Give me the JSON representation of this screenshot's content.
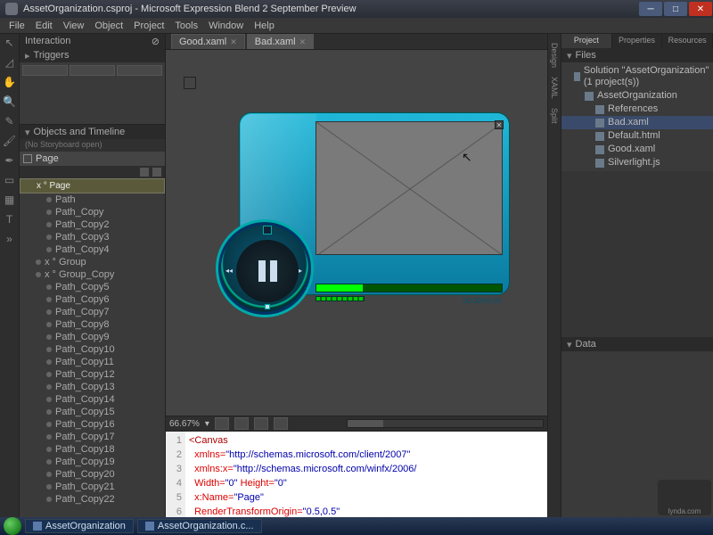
{
  "title": "AssetOrganization.csproj - Microsoft Expression Blend 2 September Preview",
  "menu": [
    "File",
    "Edit",
    "View",
    "Object",
    "Project",
    "Tools",
    "Window",
    "Help"
  ],
  "left": {
    "interaction": "Interaction",
    "triggers": "Triggers",
    "objects": "Objects and Timeline",
    "storyboard": "(No Storyboard open)",
    "root": "Page",
    "selected": "x ° Page",
    "items": [
      {
        "l": "Path",
        "g": 0
      },
      {
        "l": "Path_Copy",
        "g": 0
      },
      {
        "l": "Path_Copy2",
        "g": 0
      },
      {
        "l": "Path_Copy3",
        "g": 0
      },
      {
        "l": "Path_Copy4",
        "g": 0
      },
      {
        "l": "x ° Group",
        "g": 1
      },
      {
        "l": "x ° Group_Copy",
        "g": 1
      },
      {
        "l": "Path_Copy5",
        "g": 0
      },
      {
        "l": "Path_Copy6",
        "g": 0
      },
      {
        "l": "Path_Copy7",
        "g": 0
      },
      {
        "l": "Path_Copy8",
        "g": 0
      },
      {
        "l": "Path_Copy9",
        "g": 0
      },
      {
        "l": "Path_Copy10",
        "g": 0
      },
      {
        "l": "Path_Copy11",
        "g": 0
      },
      {
        "l": "Path_Copy12",
        "g": 0
      },
      {
        "l": "Path_Copy13",
        "g": 0
      },
      {
        "l": "Path_Copy14",
        "g": 0
      },
      {
        "l": "Path_Copy15",
        "g": 0
      },
      {
        "l": "Path_Copy16",
        "g": 0
      },
      {
        "l": "Path_Copy17",
        "g": 0
      },
      {
        "l": "Path_Copy18",
        "g": 0
      },
      {
        "l": "Path_Copy19",
        "g": 0
      },
      {
        "l": "Path_Copy20",
        "g": 0
      },
      {
        "l": "Path_Copy21",
        "g": 0
      },
      {
        "l": "Path_Copy22",
        "g": 0
      }
    ]
  },
  "tabs": [
    {
      "label": "Good.xaml",
      "active": false
    },
    {
      "label": "Bad.xaml",
      "active": true
    }
  ],
  "zoom": "66.67%",
  "sidetabs": [
    "Design",
    "XAML",
    "Split"
  ],
  "right": {
    "tabs": [
      "Project",
      "Properties",
      "Resources"
    ],
    "files_header": "Files",
    "files": [
      {
        "l": "Solution \"AssetOrganization\" (1 project(s))",
        "ind": 0
      },
      {
        "l": "AssetOrganization",
        "ind": 1
      },
      {
        "l": "References",
        "ind": 2
      },
      {
        "l": "Bad.xaml",
        "ind": 2,
        "sel": true
      },
      {
        "l": "Default.html",
        "ind": 2
      },
      {
        "l": "Good.xaml",
        "ind": 2
      },
      {
        "l": "Silverlight.js",
        "ind": 2
      }
    ],
    "data_header": "Data"
  },
  "code": {
    "lines": [
      "1",
      "2",
      "3",
      "4",
      "5",
      "6"
    ],
    "l1": "<Canvas",
    "l2a": "  xmlns=",
    "l2b": "\"http://schemas.microsoft.com/client/2007\"",
    "l3a": "  xmlns:x=",
    "l3b": "\"http://schemas.microsoft.com/winfx/2006/",
    "l4a": "  Width=",
    "l4b": "\"0\"",
    "l4c": " Height=",
    "l4d": "\"0\"",
    "l5a": "  x:Name=",
    "l5b": "\"Page\"",
    "l6a": "  RenderTransformOrigin=",
    "l6b": "\"0.5,0.5\""
  },
  "player_time": "00:00/00:00",
  "taskbar": [
    "AssetOrganization",
    "AssetOrganization.c..."
  ],
  "wm": "lynda.com"
}
